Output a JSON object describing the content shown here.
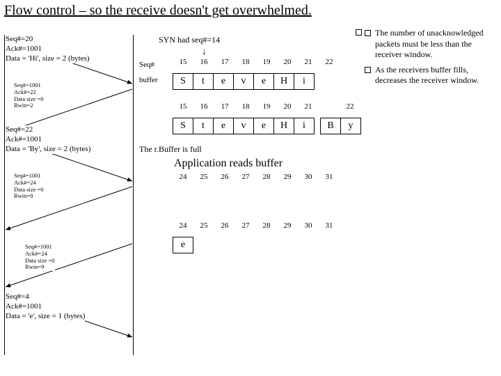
{
  "title": "Flow control – so the receive doesn't get overwhelmed.",
  "syn_label": "SYN had seq#=14",
  "labels": {
    "seq": "Seq#",
    "buffer": "buffer"
  },
  "messages": {
    "m1": "Seq#=20\nAck#=1001\nData = 'Hi', size = 2 (bytes)",
    "m2": "Seq#=1001\nAck#=22\nData size =0\nRwin=2",
    "m3": "Seq#=22\nAck#=1001\nData = 'By', size = 2 (bytes)",
    "m4": "Seq#=1001\nAck#=24\nData size =0\nRwin=0",
    "m5": "Seq#=1001\nAck#=24\nData size =0\nRwin=9",
    "m6": "Seq#=4\nAck#=1001\nData = 'e', size = 1 (bytes)"
  },
  "seqrow1": [
    "15",
    "16",
    "17",
    "18",
    "19",
    "20",
    "21",
    "22",
    ""
  ],
  "buf1": [
    "S",
    "t",
    "e",
    "v",
    "e",
    "H",
    "i",
    "",
    ""
  ],
  "seqrow2": [
    "15",
    "16",
    "17",
    "18",
    "19",
    "20",
    "21",
    "",
    "22",
    ""
  ],
  "buf2": [
    "S",
    "t",
    "e",
    "v",
    "e",
    "H",
    "i",
    "",
    "B",
    "y"
  ],
  "note_full": "The r.Buffer is full",
  "app_reads": "Application reads buffer",
  "seqrow3": [
    "24",
    "25",
    "26",
    "27",
    "28",
    "29",
    "30",
    "31",
    ""
  ],
  "buf3": [
    "",
    "",
    "",
    "",
    "",
    "",
    "",
    "",
    ""
  ],
  "seqrow4": [
    "24",
    "25",
    "26",
    "27",
    "28",
    "29",
    "30",
    "31",
    ""
  ],
  "buf4": [
    "e",
    "",
    "",
    "",
    "",
    "",
    "",
    "",
    ""
  ],
  "bullets": {
    "b1": "The number of unacknowledged packets must be less than the receiver window.",
    "b2": "As the receivers buffer fills, decreases the receiver window."
  }
}
